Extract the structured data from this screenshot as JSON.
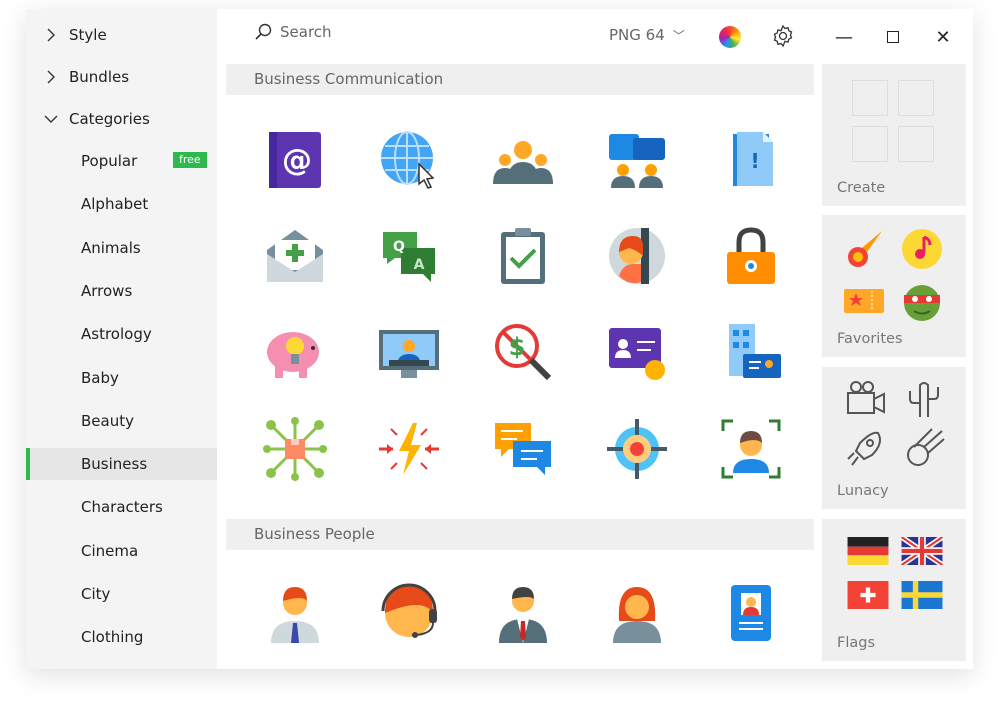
{
  "sidebar": {
    "top": [
      {
        "label": "Style",
        "expanded": false
      },
      {
        "label": "Bundles",
        "expanded": false
      },
      {
        "label": "Categories",
        "expanded": true
      }
    ],
    "categories": [
      {
        "label": "Popular",
        "badge": "free"
      },
      {
        "label": "Alphabet"
      },
      {
        "label": "Animals"
      },
      {
        "label": "Arrows"
      },
      {
        "label": "Astrology"
      },
      {
        "label": "Baby"
      },
      {
        "label": "Beauty"
      },
      {
        "label": "Business",
        "selected": true
      },
      {
        "label": "Characters"
      },
      {
        "label": "Cinema"
      },
      {
        "label": "City"
      },
      {
        "label": "Clothing"
      }
    ]
  },
  "toolbar": {
    "search_placeholder": "Search",
    "format": "PNG 64"
  },
  "sections": [
    {
      "title": "Business Communication",
      "icons": [
        "email-at-icon",
        "globe-cursor-icon",
        "group-icon",
        "conference-chat-icon",
        "notification-document-icon",
        "mail-add-icon",
        "qa-icon",
        "clipboard-check-icon",
        "profile-door-icon",
        "padlock-icon",
        "piggy-bank-icon",
        "video-conference-icon",
        "no-money-search-icon",
        "business-card-icon",
        "building-id-icon",
        "network-box-icon",
        "energy-collision-icon",
        "chat-bubbles-icon",
        "target-icon",
        "face-scan-icon"
      ]
    },
    {
      "title": "Business People",
      "icons": [
        "businessman-icon",
        "support-agent-icon",
        "manager-icon",
        "businesswoman-icon",
        "id-badge-icon"
      ]
    }
  ],
  "panels": [
    {
      "label": "Create"
    },
    {
      "label": "Favorites"
    },
    {
      "label": "Lunacy"
    },
    {
      "label": "Flags"
    }
  ],
  "colors": {
    "accent": "#2db94d"
  }
}
